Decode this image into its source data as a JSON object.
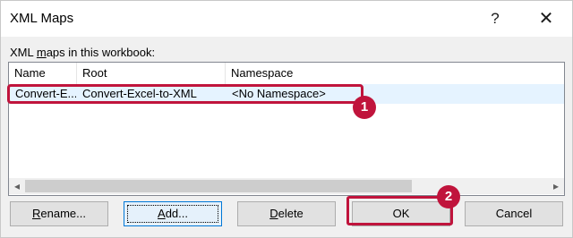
{
  "window": {
    "title": "XML Maps",
    "help_glyph": "?",
    "close_glyph": "✕"
  },
  "section": {
    "label_pre": "XML ",
    "label_mnemonic": "m",
    "label_post": "aps in this workbook:"
  },
  "list": {
    "columns": [
      "Name",
      "Root",
      "Namespace"
    ],
    "rows": [
      {
        "name": "Convert-E...",
        "root": "Convert-Excel-to-XML",
        "namespace": "<No Namespace>"
      }
    ],
    "scroll_left": "◂",
    "scroll_right": "▸"
  },
  "annotations": {
    "badge_1": "1",
    "badge_2": "2",
    "color": "#c0143c"
  },
  "buttons": {
    "rename": {
      "mnemonic": "R",
      "rest": "ename..."
    },
    "add": {
      "mnemonic": "A",
      "rest": "dd..."
    },
    "delete": {
      "mnemonic": "D",
      "rest": "elete"
    },
    "ok": "OK",
    "cancel": "Cancel"
  }
}
